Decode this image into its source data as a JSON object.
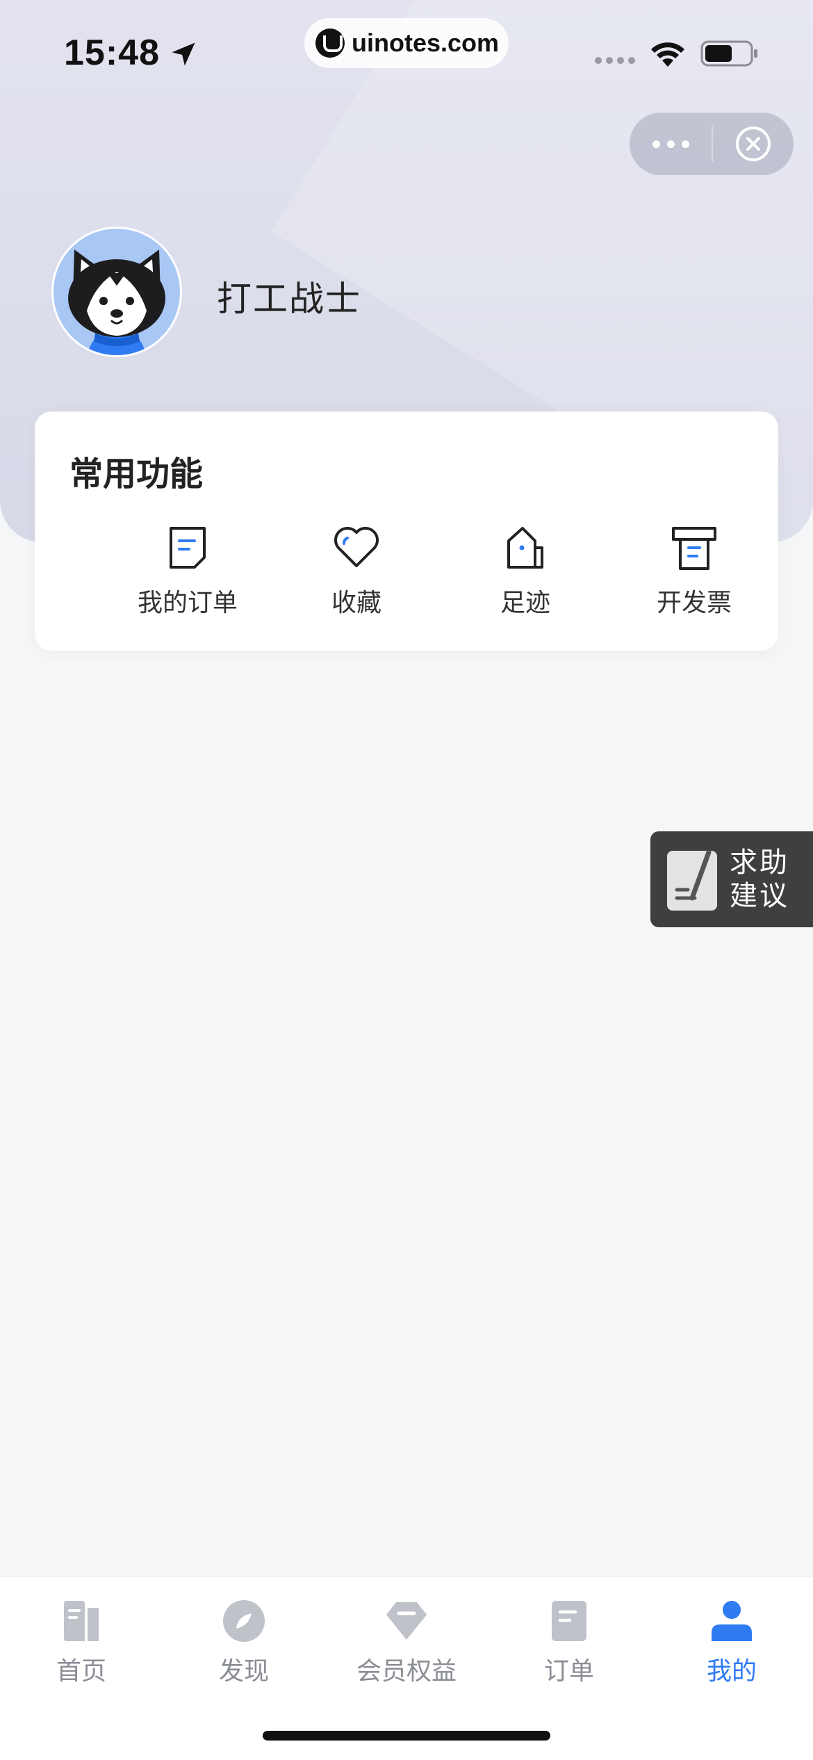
{
  "status_bar": {
    "time": "15:48",
    "url": "uinotes.com",
    "icons": [
      "location-arrow-icon",
      "signal-icon",
      "wifi-icon",
      "battery-icon"
    ]
  },
  "capsule": {
    "more_icon": "more-dots-icon",
    "close_icon": "close-circle-icon"
  },
  "profile": {
    "username": "打工战士",
    "avatar_icon": "husky-avatar"
  },
  "common_functions": {
    "title": "常用功能",
    "items": [
      {
        "label": "我的订单",
        "icon": "order-doc-icon"
      },
      {
        "label": "收藏",
        "icon": "heart-icon"
      },
      {
        "label": "足迹",
        "icon": "footprint-house-icon"
      },
      {
        "label": "开发票",
        "icon": "invoice-printer-icon"
      }
    ]
  },
  "help_float": {
    "line1": "求助",
    "line2": "建议",
    "icon": "feedback-pen-icon"
  },
  "tabbar": {
    "items": [
      {
        "label": "首页",
        "icon": "home-book-icon",
        "active": false
      },
      {
        "label": "发现",
        "icon": "compass-icon",
        "active": false
      },
      {
        "label": "会员权益",
        "icon": "diamond-icon",
        "active": false
      },
      {
        "label": "订单",
        "icon": "order-icon",
        "active": false
      },
      {
        "label": "我的",
        "icon": "user-icon",
        "active": true
      }
    ]
  },
  "colors": {
    "accent": "#2f7bf2",
    "tab_inactive": "#8a8d94",
    "icon_gray": "#bfc2c9",
    "header_bg": "#dcdde9",
    "help_bg": "#3e4040"
  }
}
